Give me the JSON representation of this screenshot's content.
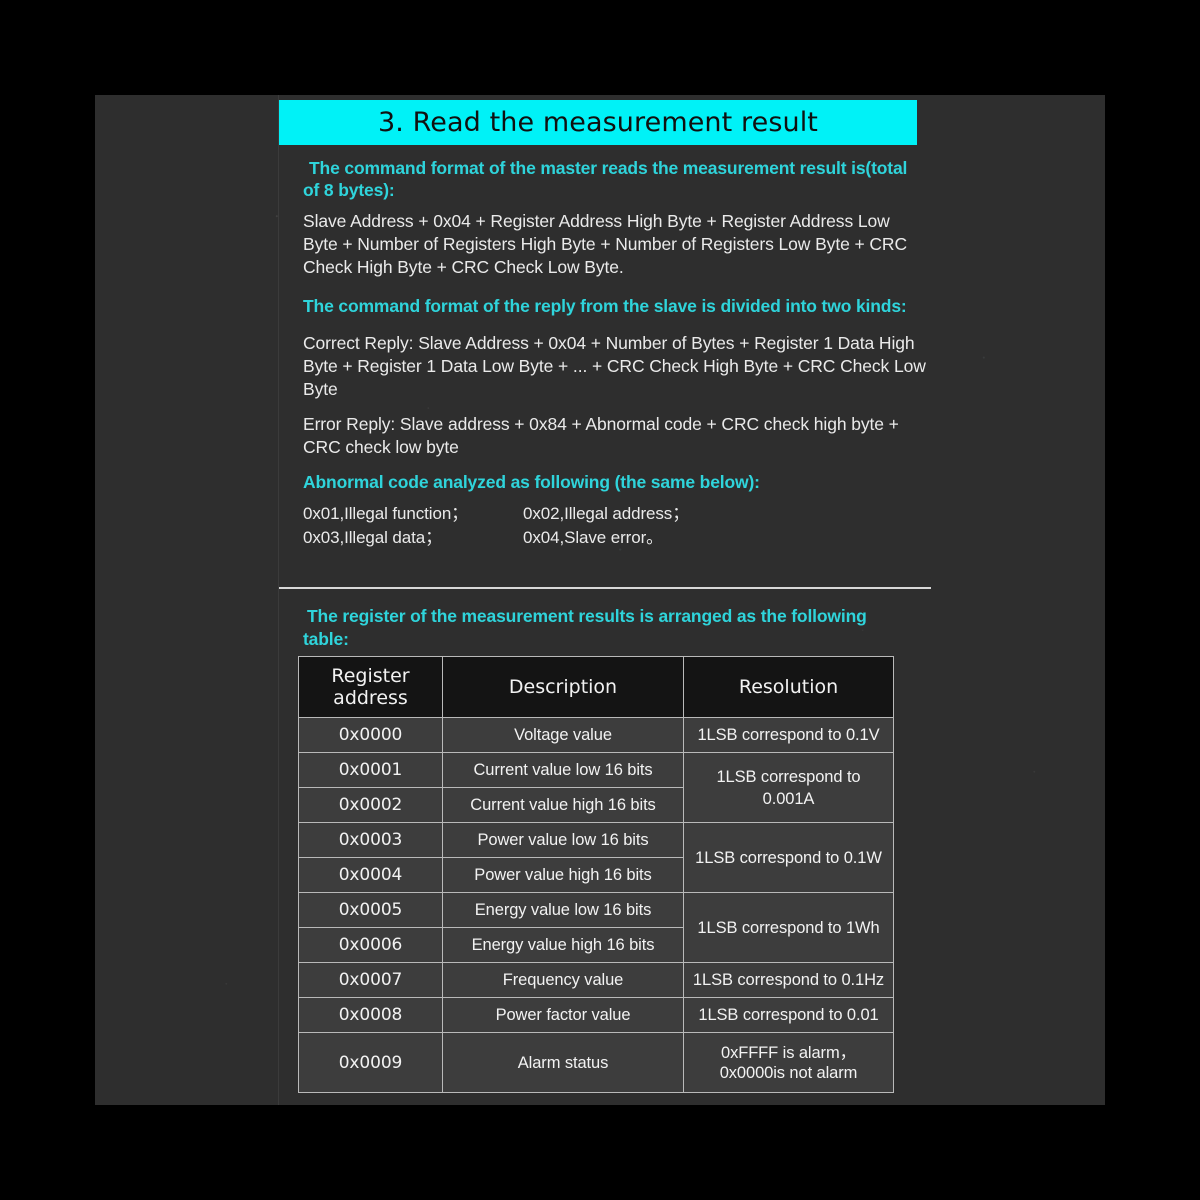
{
  "title": "3. Read the measurement result",
  "sections": {
    "master_heading": "The command format of the master reads the measurement result is(total of 8 bytes):",
    "master_body": "Slave Address + 0x04 + Register Address High Byte + Register Address Low Byte + Number of Registers High Byte + Number of Registers Low Byte + CRC Check High Byte + CRC Check Low Byte.",
    "slave_heading": "The command format of the reply from the slave is divided into two kinds:",
    "correct_reply": "Correct Reply: Slave Address + 0x04 + Number of Bytes + Register 1 Data High Byte + Register 1 Data Low Byte + ... + CRC Check High Byte + CRC Check Low Byte",
    "error_reply": "Error Reply: Slave address + 0x84 + Abnormal code + CRC check high byte + CRC check low byte",
    "abnormal_heading": "Abnormal code analyzed as following (the same below):",
    "abnormal_codes": [
      {
        "left": "0x01,Illegal function；",
        "right": "0x02,Illegal address；"
      },
      {
        "left": "0x03,Illegal data；",
        "right": "0x04,Slave error。"
      }
    ],
    "table_intro": "The register of the measurement results is arranged as the following table:"
  },
  "table": {
    "headers": [
      "Register address",
      "Description",
      "Resolution"
    ],
    "rows": [
      {
        "address": "0x0000",
        "description": "Voltage value",
        "resolution": "1LSB correspond to 0.1V",
        "res_span": 1,
        "tall": false
      },
      {
        "address": "0x0001",
        "description": "Current value low 16 bits",
        "resolution": "1LSB correspond to 0.001A",
        "res_span": 2,
        "tall": false
      },
      {
        "address": "0x0002",
        "description": "Current value high 16 bits",
        "resolution": null,
        "res_span": 0,
        "tall": false
      },
      {
        "address": "0x0003",
        "description": "Power value low 16 bits",
        "resolution": "1LSB correspond to 0.1W",
        "res_span": 2,
        "tall": false
      },
      {
        "address": "0x0004",
        "description": "Power value high 16 bits",
        "resolution": null,
        "res_span": 0,
        "tall": false
      },
      {
        "address": "0x0005",
        "description": "Energy value low 16 bits",
        "resolution": "1LSB correspond to 1Wh",
        "res_span": 2,
        "tall": false
      },
      {
        "address": "0x0006",
        "description": "Energy value high 16 bits",
        "resolution": null,
        "res_span": 0,
        "tall": false
      },
      {
        "address": "0x0007",
        "description": "Frequency value",
        "resolution": "1LSB correspond to 0.1Hz",
        "res_span": 1,
        "tall": false
      },
      {
        "address": "0x0008",
        "description": "Power factor value",
        "resolution": "1LSB correspond to 0.01",
        "res_span": 1,
        "tall": false
      },
      {
        "address": "0x0009",
        "description": "Alarm status",
        "resolution": "0xFFFF is alarm，0x0000is not alarm",
        "res_span": 1,
        "tall": true
      }
    ]
  },
  "colors": {
    "banner": "#00f2f7",
    "heading_teal": "#2fd4db",
    "page_bg": "#2e2e2e",
    "outer_bg": "#000000",
    "table_header_bg": "#141414",
    "table_cell_bg": "#3d3d3d",
    "table_border": "#b9b9b9"
  }
}
